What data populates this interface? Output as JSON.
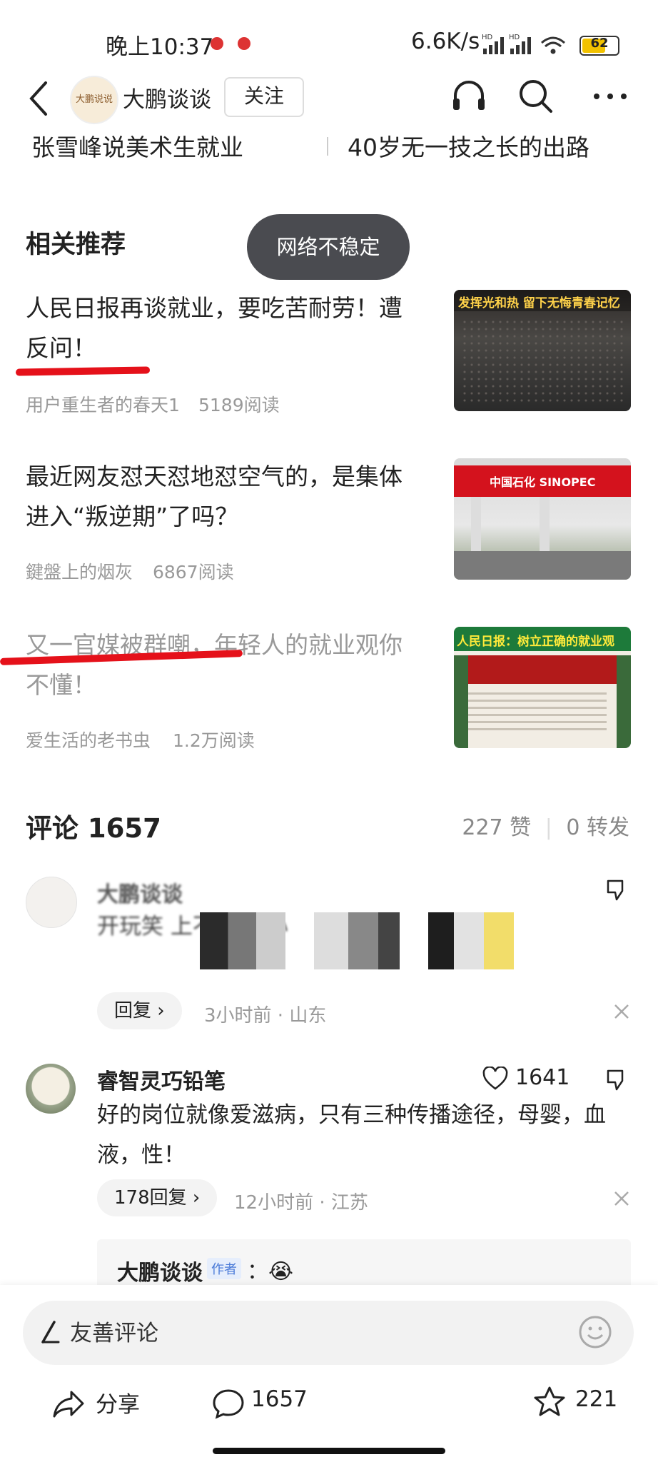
{
  "status": {
    "time": "晚上10:37",
    "speed": "6.6K/s",
    "battery": "62",
    "net1": "HD",
    "net2": "HD"
  },
  "header": {
    "author": "大鹏谈谈",
    "follow": "关注",
    "avatar_text": "大鹏说说"
  },
  "chips": [
    "张雪峰说美术生就业",
    "40岁无一技之长的出路"
  ],
  "related": {
    "title": "相关推荐",
    "toast": "网络不稳定",
    "items": [
      {
        "title": "人民日报再谈就业，要吃苦耐劳！遭反问！",
        "author": "用户重生者的春天1",
        "reads": "5189阅读",
        "thumb_caption": "发挥光和热 留下无悔青春记忆"
      },
      {
        "title": "最近网友怼天怼地怼空气的，是集体进入“叛逆期”了吗？",
        "author": "鍵盤上的烟灰",
        "reads": "6867阅读",
        "thumb_caption": "中国石化 SINOPEC"
      },
      {
        "title": "又一官媒被群嘲，年轻人的就业观你不懂！",
        "author": "爱生活的老书虫",
        "reads": "1.2万阅读",
        "thumb_caption": "人民日报：树立正确的就业观"
      }
    ]
  },
  "comments": {
    "title": "评论 1657",
    "likes": "227 赞",
    "reposts": "0 转发",
    "list": [
      {
        "user": "大鹏谈谈",
        "text_visible": "开玩笑 上不 会担心",
        "reply": "回复",
        "time": "3小时前 · 山东"
      },
      {
        "user": "睿智灵巧铅笔",
        "likes": "1641",
        "text": "好的岗位就像爱滋病，只有三种传播途径，母婴，血液，性！",
        "reply": "178回复",
        "time": "12小时前 · 江苏"
      }
    ],
    "sub_reply": {
      "user": "大鹏谈谈",
      "badge": "作者",
      "text": "：😭"
    }
  },
  "bottom": {
    "placeholder": "友善评论",
    "share": "分享",
    "comments": "1657",
    "stars": "221"
  },
  "colors": {
    "accent_red": "#e5111a",
    "toast_bg": "#4a4b50"
  }
}
